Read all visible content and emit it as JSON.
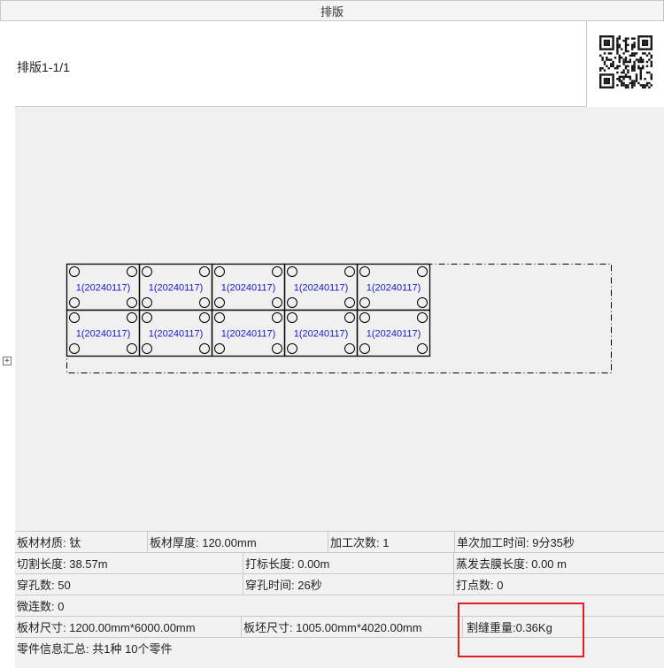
{
  "window": {
    "title": "排版"
  },
  "header": {
    "title": "排版1-1/1"
  },
  "layout": {
    "part_label": "1(20240117)",
    "rows": 2,
    "cols": 5
  },
  "info": {
    "material": "板材材质: 钛",
    "thickness": "板材厚度: 120.00mm",
    "process_count": "加工次数: 1",
    "single_time": "单次加工时间: 9分35秒",
    "cut_length": "切割长度: 38.57m",
    "mark_length": "打标长度: 0.00m",
    "evap_length": "蒸发去膜长度: 0.00 m",
    "pierce_count": "穿孔数: 50",
    "pierce_time": "穿孔时间: 26秒",
    "dot_count": "打点数: 0",
    "micro_joint": "微连数: 0",
    "sheet_size": "板材尺寸:  1200.00mm*6000.00mm",
    "blank_size": "板坯尺寸:  1005.00mm*4020.00mm",
    "kerf_weight": "割缝重量:0.36Kg",
    "parts_summary": "零件信息汇总:  共1种 10个零件"
  },
  "colors": {
    "highlight": "#e02020",
    "part_text": "#1a1acc",
    "canvas_bg": "#f0f0f0"
  }
}
